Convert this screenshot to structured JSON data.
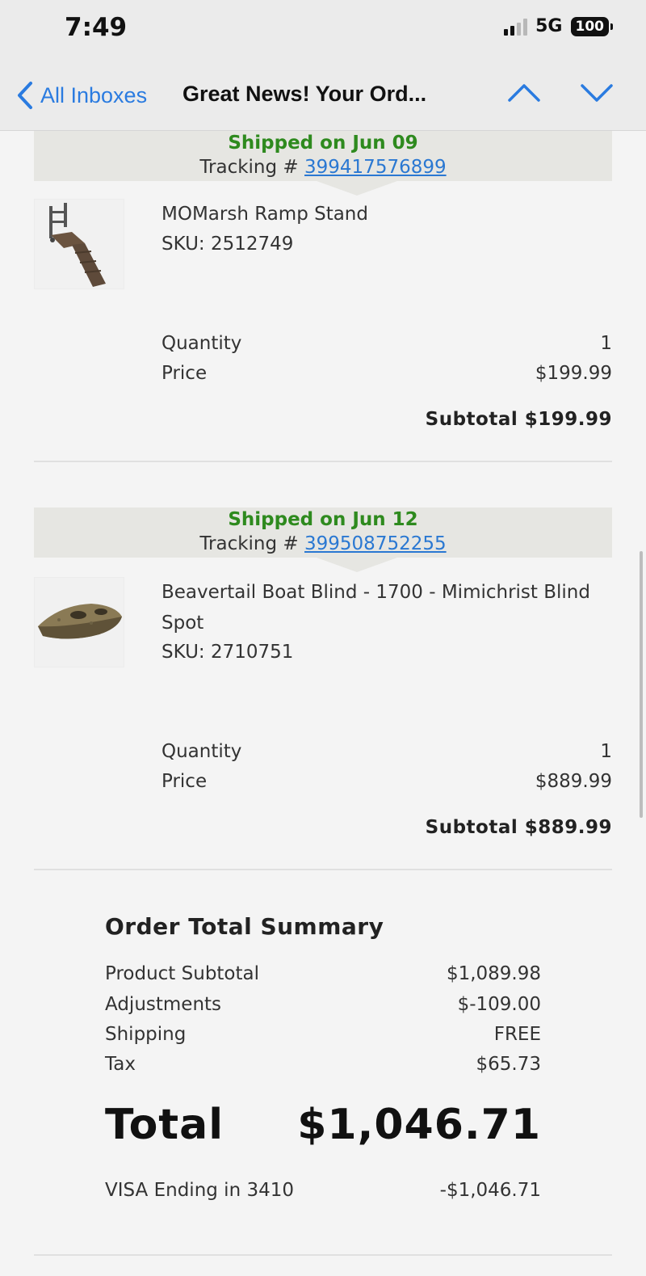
{
  "status_bar": {
    "time": "7:49",
    "network": "5G",
    "battery": "100"
  },
  "nav": {
    "back_label": "All Inboxes",
    "title": "Great News! Your Ord..."
  },
  "shipments": [
    {
      "status": "Shipped on Jun 09",
      "tracking_label": "Tracking #",
      "tracking_number": "399417576899",
      "product_name": "MOMarsh Ramp Stand",
      "sku": "SKU: 2512749",
      "quantity_label": "Quantity",
      "quantity": "1",
      "price_label": "Price",
      "price": "$199.99",
      "subtotal": "Subtotal $199.99"
    },
    {
      "status": "Shipped on Jun 12",
      "tracking_label": "Tracking #",
      "tracking_number": "399508752255",
      "product_name": "Beavertail Boat Blind - 1700 - Mimichrist Blind Spot",
      "sku": "SKU: 2710751",
      "quantity_label": "Quantity",
      "quantity": "1",
      "price_label": "Price",
      "price": "$889.99",
      "subtotal": "Subtotal $889.99"
    }
  ],
  "summary": {
    "title": "Order Total Summary",
    "rows": [
      {
        "label": "Product Subtotal",
        "value": "$1,089.98"
      },
      {
        "label": "Adjustments",
        "value": "$-109.00"
      },
      {
        "label": "Shipping",
        "value": "FREE"
      },
      {
        "label": "Tax",
        "value": "$65.73"
      }
    ],
    "total_label": "Total",
    "total_value": "$1,046.71",
    "payment_label": "VISA Ending in 3410",
    "payment_value": "-$1,046.71"
  },
  "colors": {
    "link": "#2a78d2",
    "shipped": "#2e8a1e",
    "ios_blue": "#2a7be0"
  }
}
